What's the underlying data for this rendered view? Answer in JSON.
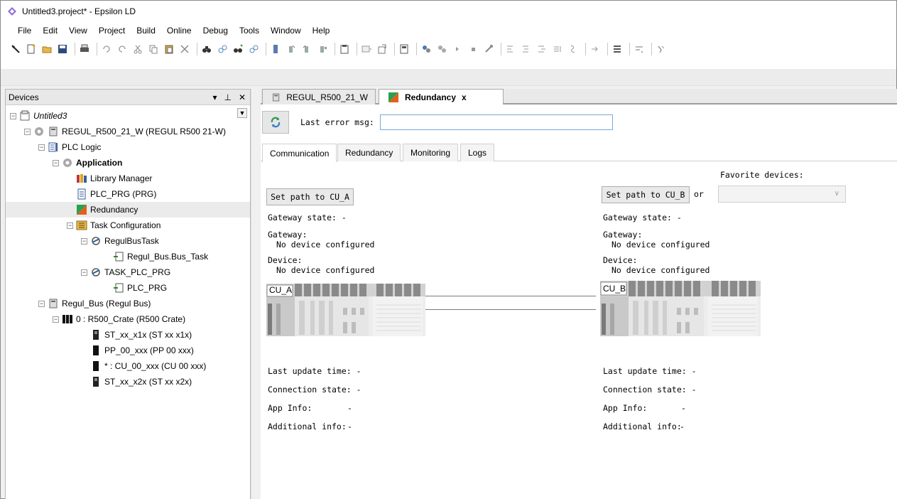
{
  "window": {
    "title": "Untitled3.project* - Epsilon LD"
  },
  "menu": [
    "File",
    "Edit",
    "View",
    "Project",
    "Build",
    "Online",
    "Debug",
    "Tools",
    "Window",
    "Help"
  ],
  "devices_panel": {
    "title": "Devices",
    "controls": [
      "▾",
      "⊥",
      "✕"
    ],
    "tree": [
      {
        "label": "Untitled3",
        "italic": true,
        "icon": "project-icon"
      },
      {
        "label": "REGUL_R500_21_W (REGUL R500 21-W)",
        "icon": "device-icon"
      },
      {
        "label": "PLC Logic",
        "icon": "plc-logic-icon"
      },
      {
        "label": "Application",
        "bold": true,
        "icon": "application-icon"
      },
      {
        "label": "Library Manager",
        "icon": "library-icon"
      },
      {
        "label": "PLC_PRG (PRG)",
        "icon": "program-icon"
      },
      {
        "label": "Redundancy",
        "icon": "redundancy-icon",
        "selected": true
      },
      {
        "label": "Task Configuration",
        "icon": "task-config-icon"
      },
      {
        "label": "RegulBusTask",
        "icon": "task-icon"
      },
      {
        "label": "Regul_Bus.Bus_Task",
        "icon": "call-icon"
      },
      {
        "label": "TASK_PLC_PRG",
        "icon": "task-icon"
      },
      {
        "label": "PLC_PRG",
        "icon": "call-icon"
      },
      {
        "label": "Regul_Bus (Regul Bus)",
        "icon": "bus-icon"
      },
      {
        "label": "0 : R500_Crate (R500 Crate)",
        "icon": "crate-icon"
      },
      {
        "label": "ST_xx_x1x (ST xx x1x)",
        "icon": "module-icon"
      },
      {
        "label": "PP_00_xxx (PP 00 xxx)",
        "icon": "module-icon"
      },
      {
        "label": "* : CU_00_xxx (CU 00 xxx)",
        "icon": "module-icon"
      },
      {
        "label": "ST_xx_x2x (ST xx x2x)",
        "icon": "module-icon"
      }
    ]
  },
  "editor": {
    "tabs": [
      {
        "label": "REGUL_R500_21_W",
        "active": false
      },
      {
        "label": "Redundancy",
        "active": true,
        "close": "x"
      }
    ],
    "last_error_label": "Last error msg:",
    "last_error_value": "",
    "sub_tabs": [
      {
        "label": "Communication",
        "active": true
      },
      {
        "label": "Redundancy",
        "active": false
      },
      {
        "label": "Monitoring",
        "active": false
      },
      {
        "label": "Logs",
        "active": false
      }
    ],
    "favorite_devices_label": "Favorite devices:",
    "or_label": "or",
    "cu_a": {
      "button": "Set path to CU_A",
      "gateway_state": "Gateway state:  -",
      "gateway_label": "Gateway:",
      "gateway_value": "No device configured",
      "device_label": "Device:",
      "device_value": "No device configured",
      "image_label": "CU_A",
      "last_update": "Last update time:  -",
      "connection_state": "Connection state:  -",
      "app_info_label": "App Info:",
      "app_info_value": "-",
      "additional_info_label": "Additional info:",
      "additional_info_value": "-"
    },
    "cu_b": {
      "button": "Set path to CU_B",
      "gateway_state": "Gateway state:  -",
      "gateway_label": "Gateway:",
      "gateway_value": "No device configured",
      "device_label": "Device:",
      "device_value": "No device configured",
      "image_label": "CU_B",
      "last_update": "Last update time:  -",
      "connection_state": "Connection state:  -",
      "app_info_label": "App Info:",
      "app_info_value": "-",
      "additional_info_label": "Additional info:",
      "additional_info_value": "-"
    }
  }
}
